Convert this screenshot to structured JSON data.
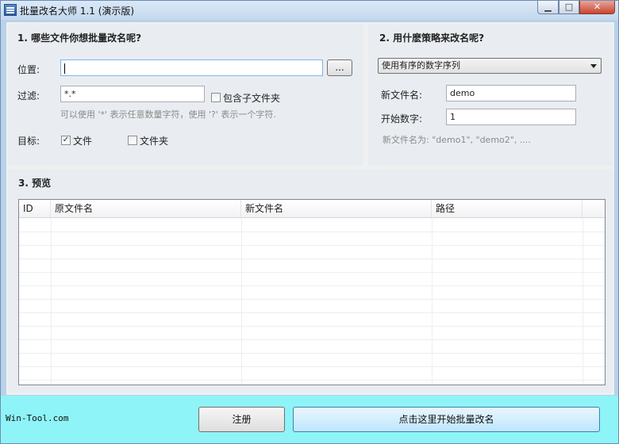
{
  "window": {
    "title": "批量改名大师 1.1 (演示版)",
    "minimize_glyph": "▁",
    "maximize_glyph": "□",
    "close_glyph": "✕"
  },
  "section1": {
    "title": "1. 哪些文件你想批量改名呢?",
    "location_label": "位置:",
    "location_value": "",
    "browse_label": "...",
    "filter_label": "过滤:",
    "filter_value": "*.*",
    "include_sub_label": "包含子文件夹",
    "include_sub_checked": false,
    "hint": "可以使用 '*' 表示任意数量字符，使用 '?' 表示一个字符.",
    "target_label": "目标:",
    "target_file_label": "文件",
    "target_file_checked": true,
    "target_folder_label": "文件夹",
    "target_folder_checked": false,
    "check_mark": "✓"
  },
  "section2": {
    "title": "2. 用什麽策略来改名呢?",
    "strategy_selected": "使用有序的数字序列",
    "new_name_label": "新文件名:",
    "new_name_value": "demo",
    "start_number_label": "开始数字:",
    "start_number_value": "1",
    "preview_hint": "新文件名为:  \"demo1\", \"demo2\", ...."
  },
  "section3": {
    "title": "3. 预览",
    "columns": [
      "ID",
      "原文件名",
      "新文件名",
      "路径"
    ],
    "rows": []
  },
  "footer": {
    "site": "Win-Tool.com",
    "register_label": "注册",
    "start_label": "点击这里开始批量改名"
  }
}
